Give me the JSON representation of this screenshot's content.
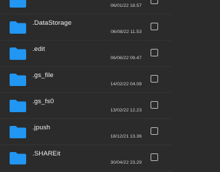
{
  "colors": {
    "background": "#2b2b2b",
    "folder": "#2196f3",
    "text": "#f2f2f2",
    "subtext": "#cfcfcf",
    "checkbox": "#bdbdbd"
  },
  "items": [
    {
      "name": "",
      "date": "06/01/22 18.57",
      "icon": "folder-icon",
      "checked": false
    },
    {
      "name": ".DataStorage",
      "date": "06/08/22 11.53",
      "icon": "folder-icon",
      "checked": false
    },
    {
      "name": ".edit",
      "date": "06/06/22 09.47",
      "icon": "folder-icon",
      "checked": false
    },
    {
      "name": ".gs_file",
      "date": "14/02/22 04.08",
      "icon": "folder-icon",
      "checked": false
    },
    {
      "name": ".gs_fs0",
      "date": "13/02/22 12.23",
      "icon": "folder-icon",
      "checked": false
    },
    {
      "name": ".jpush",
      "date": "18/12/21 13.36",
      "icon": "folder-icon",
      "checked": false
    },
    {
      "name": ".SHAREit",
      "date": "30/04/22 23.29",
      "icon": "folder-icon",
      "checked": false
    }
  ]
}
